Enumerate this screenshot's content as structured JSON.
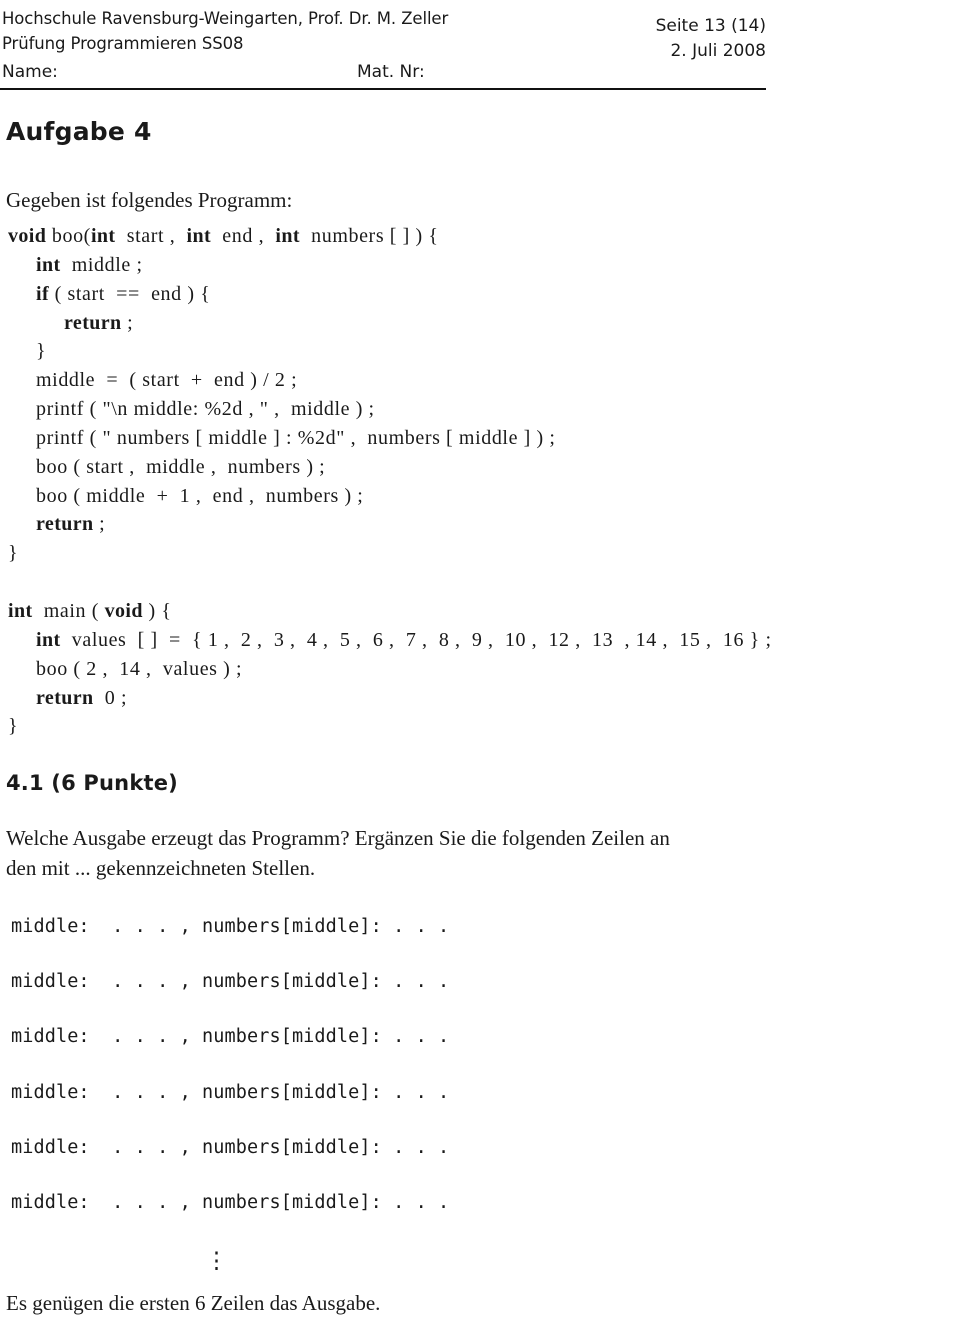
{
  "header": {
    "institution_line1": "Hochschule Ravensburg-Weingarten, Prof. Dr. M. Zeller",
    "institution_line2": "Prüfung Programmieren SS08",
    "page_label": "Seite 13 (14)",
    "date": "2. Juli 2008",
    "name_label": "Name:",
    "matnr_label": "Mat. Nr:"
  },
  "task": {
    "heading": "Aufgabe 4",
    "intro": "Gegeben ist folgendes Programm:"
  },
  "code_listing": {
    "lines": [
      "<b>void</b> boo(<b>int</b>  start ,  <b>int</b>  end ,  <b>int</b>  numbers [ ] ) {",
      "     <b>int</b>  middle ;",
      "     <b>if</b> ( start  ==  end ) {",
      "          <b>return</b> ;",
      "     }",
      "     middle  =  ( start  +  end ) / 2 ;",
      "     printf ( \"\\n middle: %2d , \" ,  middle ) ;",
      "     printf ( \" numbers [ middle ] : %2d\" ,  numbers [ middle ] ) ;",
      "     boo ( start ,  middle ,  numbers ) ;",
      "     boo ( middle  +  1 ,  end ,  numbers ) ;",
      "     <b>return</b> ;",
      "}",
      "",
      "<b>int</b>  main ( <b>void</b> ) {",
      "     <b>int</b>  values  [ ]  =  { 1 ,  2 ,  3 ,  4 ,  5 ,  6 ,  7 ,  8 ,  9 ,  10 ,  12 ,  13  , 14 ,  15 ,  16 } ;",
      "     boo ( 2 ,  14 ,  values ) ;",
      "     <b>return</b>  0 ;",
      "}"
    ]
  },
  "subtask": {
    "heading": "4.1 (6 Punkte)",
    "question_line1": "Welche Ausgabe erzeugt das Programm? Ergänzen Sie die folgenden Zeilen an",
    "question_line2": "den mit ... gekennzeichneten Stellen.",
    "answer_lines": [
      "middle:  . . . , numbers[middle]: . . .",
      "middle:  . . . , numbers[middle]: . . .",
      "middle:  . . . , numbers[middle]: . . .",
      "middle:  . . . , numbers[middle]: . . .",
      "middle:  . . . , numbers[middle]: . . .",
      "middle:  . . . , numbers[middle]: . . ."
    ],
    "vertical_dots": "⋮",
    "footnote": "Es genügen die ersten 6 Zeilen das Ausgabe."
  }
}
